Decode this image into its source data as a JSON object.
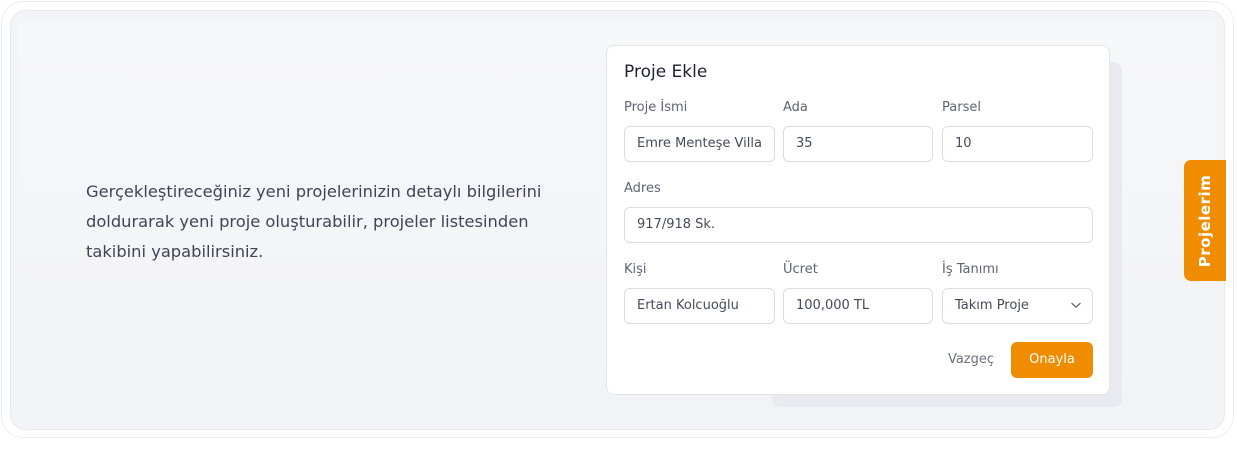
{
  "description": "Gerçekleştireceğiniz yeni projelerinizin detaylı bilgilerini doldurarak yeni proje oluşturabilir, projeler listesinden takibini yapabilirsiniz.",
  "form": {
    "title": "Proje Ekle",
    "project_name": {
      "label": "Proje İsmi",
      "value": "Emre Menteşe Villa"
    },
    "block": {
      "label": "Ada",
      "value": "35"
    },
    "parcel": {
      "label": "Parsel",
      "value": "10"
    },
    "address": {
      "label": "Adres",
      "value": "917/918 Sk."
    },
    "person": {
      "label": "Kişi",
      "value": "Ertan Kolcuoğlu"
    },
    "fee": {
      "label": "Ücret",
      "value": "100,000 TL"
    },
    "job": {
      "label": "İş Tanımı",
      "value": "Takım Proje"
    },
    "cancel_label": "Vazgeç",
    "confirm_label": "Onayla"
  },
  "side_tab": {
    "label": "Projelerim"
  },
  "colors": {
    "accent": "#f08c00"
  },
  "icons": {
    "job_select": "chevron-down-icon"
  }
}
